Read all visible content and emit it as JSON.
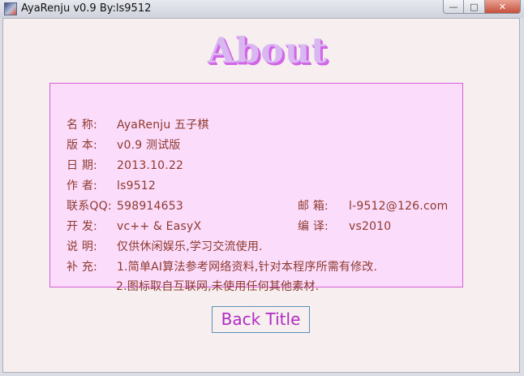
{
  "window": {
    "title": "AyaRenju v0.9 By:ls9512",
    "minimize_glyph": "—",
    "maximize_glyph": "□",
    "close_glyph": "✕"
  },
  "heading": "About",
  "info": {
    "name_label": "名  称:",
    "name_value": "AyaRenju 五子棋",
    "version_label": "版  本:",
    "version_value": "v0.9 测试版",
    "date_label": "日  期:",
    "date_value": "2013.10.22",
    "author_label": "作  者:",
    "author_value": "ls9512",
    "qq_label": "联系QQ:",
    "qq_value": "598914653",
    "email_label": "邮  箱:",
    "email_value": "l-9512@126.com",
    "dev_label": "开  发:",
    "dev_value": "vc++ & EasyX",
    "compile_label": "编  译:",
    "compile_value": "vs2010",
    "desc_label": "说  明:",
    "desc_value": "仅供休闲娱乐,学习交流使用.",
    "extra_label": "补  充:",
    "extra_line1": "1.简单AI算法参考网络资料,针对本程序所需有修改.",
    "extra_line2": "2.图标取自互联网,未使用任何其他素材."
  },
  "back_button": "Back Title",
  "colors": {
    "background": "#f7efef",
    "info_box_fill": "#fcdcfb",
    "info_box_border": "#d25fd6",
    "text": "#8c3a2e",
    "heading_fill": "#d9b8f2",
    "heading_shadow": "#d466e8",
    "button_text": "#b02ac2",
    "button_border": "#5a8fb8"
  }
}
